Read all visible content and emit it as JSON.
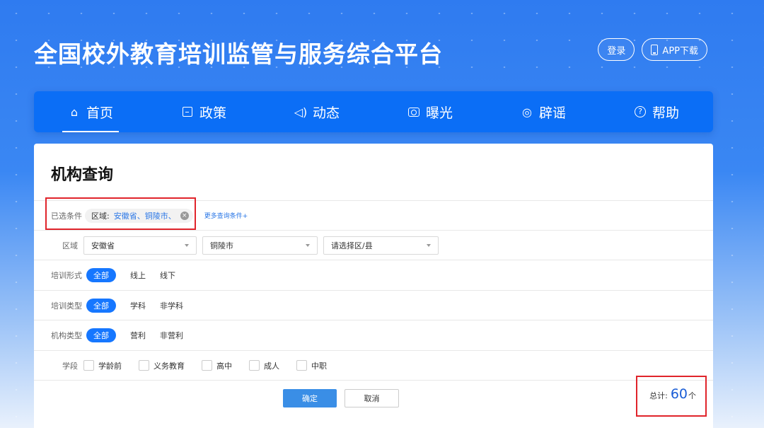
{
  "header": {
    "title": "全国校外教育培训监管与服务综合平台",
    "login_label": "登录",
    "app_download_label": "APP下载"
  },
  "nav": {
    "items": [
      {
        "label": "首页",
        "icon": "home-icon",
        "active": true
      },
      {
        "label": "政策",
        "icon": "policy-icon",
        "active": false
      },
      {
        "label": "动态",
        "icon": "speaker-icon",
        "active": false
      },
      {
        "label": "曝光",
        "icon": "camera-icon",
        "active": false
      },
      {
        "label": "辟谣",
        "icon": "magnifier-icon",
        "active": false
      },
      {
        "label": "帮助",
        "icon": "help-icon",
        "active": false
      }
    ]
  },
  "main": {
    "title": "机构查询",
    "selected": {
      "label": "已选条件",
      "tag_key": "区域:",
      "tag_value": "安徽省、铜陵市、",
      "more_link": "更多查询条件+"
    },
    "region": {
      "label": "区域",
      "province": "安徽省",
      "city": "铜陵市",
      "district_placeholder": "请选择区/县"
    },
    "training_form": {
      "label": "培训形式",
      "options": [
        "全部",
        "线上",
        "线下"
      ],
      "selected": "全部"
    },
    "training_type": {
      "label": "培训类型",
      "options": [
        "全部",
        "学科",
        "非学科"
      ],
      "selected": "全部"
    },
    "org_type": {
      "label": "机构类型",
      "options": [
        "全部",
        "营利",
        "非营利"
      ],
      "selected": "全部"
    },
    "stage": {
      "label": "学段",
      "options": [
        "学龄前",
        "义务教育",
        "高中",
        "成人",
        "中职"
      ]
    },
    "confirm_label": "确定",
    "cancel_label": "取消",
    "total": {
      "prefix": "总计:",
      "count": "60",
      "unit": "个"
    }
  },
  "colors": {
    "primary": "#0b6ef6",
    "accent": "#1677ff",
    "highlight_box": "#e0242b"
  }
}
